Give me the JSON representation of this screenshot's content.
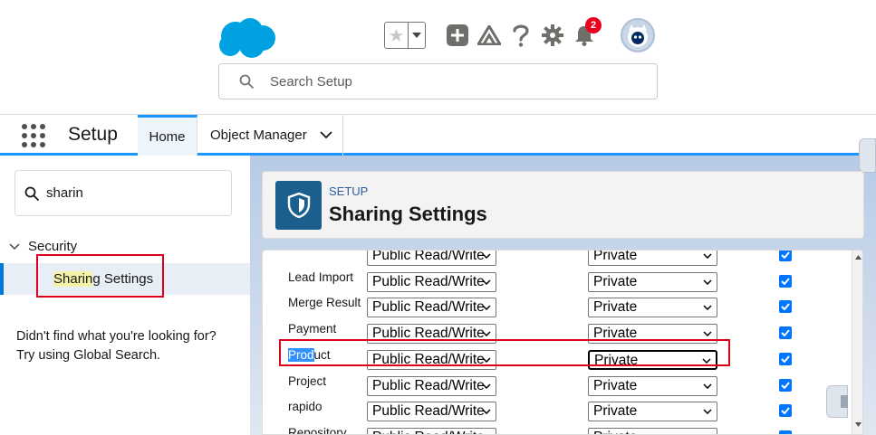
{
  "header": {
    "search_placeholder": "Search Setup",
    "notifications_count": "2"
  },
  "nav": {
    "app_name": "Setup",
    "tabs": [
      {
        "label": "Home"
      },
      {
        "label": "Object Manager"
      }
    ]
  },
  "sidebar": {
    "quickfind_value": "sharin",
    "section_label": "Security",
    "item": {
      "label_highlight": "Sharin",
      "label_rest": "g Settings"
    },
    "help_line1": "Didn't find what you're looking for?",
    "help_line2": "Try using Global Search."
  },
  "page_header": {
    "eyebrow": "SETUP",
    "title": "Sharing Settings"
  },
  "table": {
    "rows": [
      {
        "label": "",
        "default_access": "Public Read/Write",
        "external_access": "Private",
        "grant_access": true
      },
      {
        "label": "Lead Import",
        "default_access": "Public Read/Write",
        "external_access": "Private",
        "grant_access": true
      },
      {
        "label": "Merge Result",
        "default_access": "Public Read/Write",
        "external_access": "Private",
        "grant_access": true
      },
      {
        "label": "Payment",
        "default_access": "Public Read/Write",
        "external_access": "Private",
        "grant_access": true
      },
      {
        "label_highlight": "Prod",
        "label_rest": "uct",
        "default_access": "Public Read/Write",
        "external_access": "Private",
        "grant_access": true
      },
      {
        "label": "Project",
        "default_access": "Public Read/Write",
        "external_access": "Private",
        "grant_access": true
      },
      {
        "label": "rapido",
        "default_access": "Public Read/Write",
        "external_access": "Private",
        "grant_access": true
      },
      {
        "label": "Repository",
        "default_access": "Public Read/Write",
        "external_access": "Private",
        "grant_access": true
      }
    ]
  },
  "colors": {
    "brand_blue": "#0176d3",
    "highlight_red": "#e0001b",
    "checkbox_blue": "#0075ff"
  }
}
